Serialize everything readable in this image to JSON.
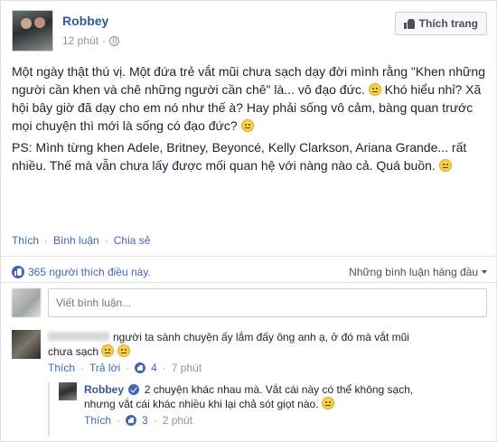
{
  "post": {
    "author": "Robbey",
    "time": "12 phút",
    "like_page_label": "Thích trang",
    "paragraph1_a": "Một ngày thật thú vị. Một đứa trẻ vắt mũi chưa sạch dạy đời mình rằng \"Khen những người cần khen và chê những người cần chê\" là... vô đạo đức.",
    "paragraph1_b": "Khó hiểu nhỉ? Xã hội bây giờ đã dạy cho em nó như thế à? Hay phải sống vô cảm, bàng quan trước mọi chuyện thì mới là sống có đạo đức?",
    "paragraph2": "PS: Mình từng khen Adele, Britney, Beyoncé, Kelly Clarkson, Ariana Grande... rất nhiều. Thế mà vẫn chưa lấy được mối quan hệ với nàng nào cả. Quá buồn.",
    "actions": {
      "like": "Thích",
      "comment": "Bình luận",
      "share": "Chia sẻ",
      "separator": "·"
    }
  },
  "reactions": {
    "like_count_text": "365 người thích điều này.",
    "sort_label": "Những bình luận hàng đầu"
  },
  "comment_box": {
    "placeholder": "Viết bình luận..."
  },
  "comments": [
    {
      "text_line1": "người ta sành chuyện ấy lắm đấy ông anh ạ, ở đó mà vắt mũi",
      "text_line2": "chưa sạch",
      "like": "Thích",
      "reply": "Trả lời",
      "likes": "4",
      "time": "7 phút"
    }
  ],
  "reply": {
    "author": "Robbey",
    "text_line1": "2 chuyện khác nhau mà. Vắt cái này có thể không sạch,",
    "text_line2": "nhưng vắt cái khác nhiều khi lại chả sót giọt nào.",
    "like": "Thích",
    "likes": "3",
    "time": "2 phút"
  },
  "colors": {
    "link": "#4267b2",
    "name": "#365899",
    "meta": "#90949c"
  }
}
